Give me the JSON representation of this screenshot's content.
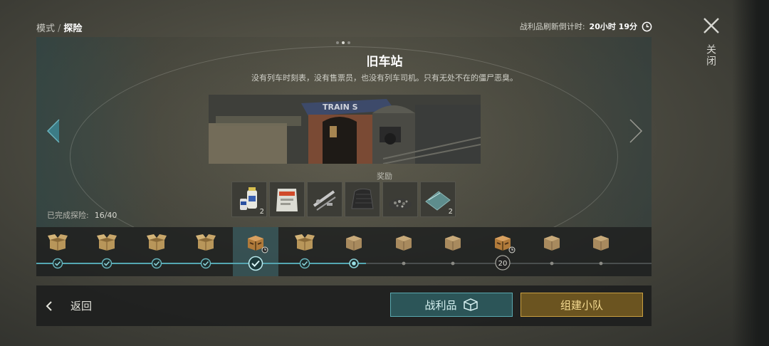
{
  "breadcrumb": {
    "parent": "模式",
    "separator": "/",
    "current": "探险"
  },
  "countdown": {
    "label": "战利品刷新倒计时:",
    "value": "20小时 19分"
  },
  "close": {
    "label": "关闭"
  },
  "expedition": {
    "title": "旧车站",
    "description": "没有列车时刻表，没有售票员，也没有列车司机。只有无处不在的僵尸恶臭。",
    "scene_sign": "TRAIN S",
    "page_dots": 3,
    "active_page": 1
  },
  "rewards": {
    "label": "奖励",
    "items": [
      {
        "name": "bottles",
        "count": "2"
      },
      {
        "name": "cement-bag",
        "count": ""
      },
      {
        "name": "metal-parts",
        "count": ""
      },
      {
        "name": "rubber-sheet",
        "count": ""
      },
      {
        "name": "gravel",
        "count": ""
      },
      {
        "name": "glass",
        "count": "2"
      }
    ]
  },
  "progress": {
    "label": "已完成探险:",
    "value": "16/40"
  },
  "timeline": {
    "nodes": [
      {
        "state": "done",
        "box": "open",
        "timer": false
      },
      {
        "state": "done",
        "box": "open",
        "timer": false
      },
      {
        "state": "done",
        "box": "open",
        "timer": false
      },
      {
        "state": "done",
        "box": "open",
        "timer": false
      },
      {
        "state": "selected",
        "box": "special",
        "timer": true
      },
      {
        "state": "done",
        "box": "open",
        "timer": false
      },
      {
        "state": "current",
        "box": "closed",
        "timer": false
      },
      {
        "state": "locked",
        "box": "closed",
        "timer": false
      },
      {
        "state": "locked",
        "box": "closed",
        "timer": false
      },
      {
        "state": "level",
        "box": "special",
        "timer": true,
        "level": "20"
      },
      {
        "state": "locked",
        "box": "closed",
        "timer": false
      },
      {
        "state": "locked",
        "box": "closed",
        "timer": false
      }
    ]
  },
  "bottom": {
    "back_label": "返回",
    "loot_label": "战利品",
    "team_label": "组建小队"
  },
  "colors": {
    "accent": "#54a7b2",
    "team_border": "#caa040",
    "team_text": "#f6dc92"
  }
}
